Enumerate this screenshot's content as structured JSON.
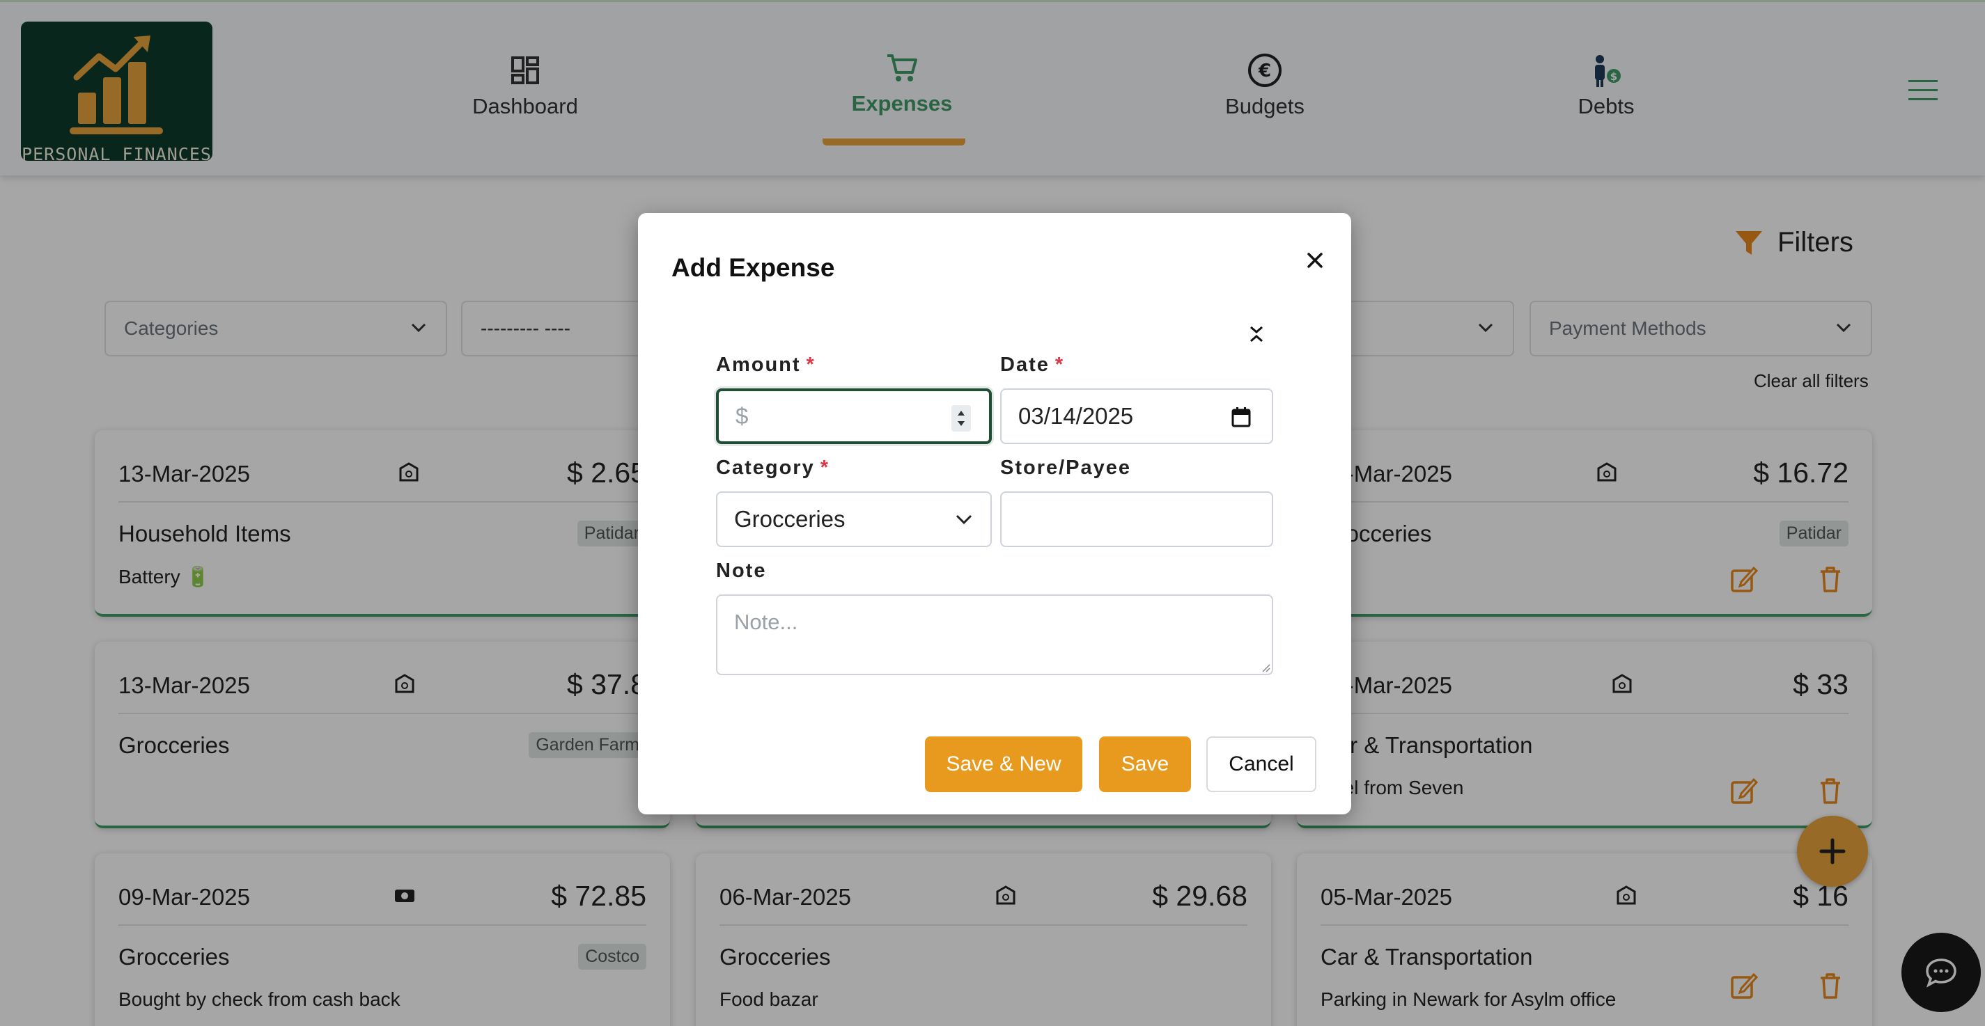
{
  "app": {
    "logo_text": "PERSONAL FINANCES"
  },
  "nav": {
    "items": [
      {
        "label": "Dashboard",
        "icon": "dashboard-icon",
        "active": false
      },
      {
        "label": "Expenses",
        "icon": "cart-icon",
        "active": true
      },
      {
        "label": "Budgets",
        "icon": "euro-icon",
        "active": false
      },
      {
        "label": "Debts",
        "icon": "person-dollar-icon",
        "active": false
      }
    ]
  },
  "filters": {
    "button_label": "Filters",
    "categories_placeholder": "Categories",
    "second_select_value": "--------- ----",
    "payment_methods_placeholder": "Payment Methods",
    "clear_all": "Clear all filters"
  },
  "expenses": [
    {
      "date": "13-Mar-2025",
      "method_icon": "bank-icon",
      "amount": "$ 2.65",
      "category": "Household Items",
      "store": "Patidar",
      "note": "Battery 🔋"
    },
    {
      "date": "13-Mar-2025",
      "method_icon": "bank-icon",
      "amount": "$ 16.72",
      "category": "Grocceries",
      "store": "Patidar",
      "note": ""
    },
    {
      "date": "13-Mar-2025",
      "method_icon": "bank-icon",
      "amount": "$ 37.8",
      "category": "Grocceries",
      "store": "Garden Farm",
      "note": ""
    },
    {
      "date": "13-Mar-2025",
      "method_icon": "bank-icon",
      "amount": "$ 33",
      "category": "Car & Transportation",
      "store": "",
      "note": "Fuel from Seven"
    },
    {
      "date": "09-Mar-2025",
      "method_icon": "cash-icon",
      "amount": "$ 72.85",
      "category": "Grocceries",
      "store": "Costco",
      "note": "Bought by check from cash back"
    },
    {
      "date": "06-Mar-2025",
      "method_icon": "bank-icon",
      "amount": "$ 29.68",
      "category": "Grocceries",
      "store": "",
      "note": "Food bazar"
    },
    {
      "date": "05-Mar-2025",
      "method_icon": "bank-icon",
      "amount": "$ 16",
      "category": "Car & Transportation",
      "store": "",
      "note": "Parking in Newark for Asylm office"
    }
  ],
  "modal": {
    "title": "Add Expense",
    "amount_label": "Amount",
    "amount_placeholder": "$",
    "date_label": "Date",
    "date_value": "03/14/2025",
    "category_label": "Category",
    "category_value": "Grocceries",
    "store_label": "Store/Payee",
    "store_value": "",
    "note_label": "Note",
    "note_placeholder": "Note...",
    "required_mark": "*",
    "save_new_label": "Save & New",
    "save_label": "Save",
    "cancel_label": "Cancel"
  },
  "colors": {
    "brand_green": "#3f9a68",
    "accent_orange": "#e8a33c",
    "logo_bg": "#0e3b2c",
    "required_red": "#dc3545"
  }
}
